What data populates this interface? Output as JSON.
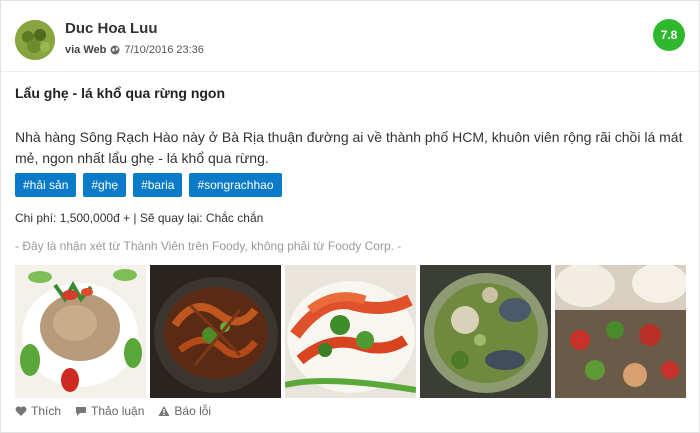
{
  "review": {
    "author": "Duc Hoa Luu",
    "via": "via Web",
    "date": "7/10/2016 23:36",
    "score": "7.8",
    "title": "Lẩu ghẹ - lá khổ qua rừng ngon",
    "body": "Nhà hàng Sông Rạch Hào này ở Bà Rịa thuận đường ai về thành phố HCM, khuôn viên rộng rãi chồi lá mát mẻ, ngon nhất lẩu ghẹ - lá khổ qua rừng.",
    "tags": [
      "#hải sản",
      "#ghẹ",
      "#baria",
      "#songrachhao"
    ],
    "cost_line": "Chi phí: 1,500,000đ + | Sẽ quay lại: Chắc chắn",
    "disclaimer": "- Đây là nhận xét từ Thành Viên trên Foody, không phải từ Foody Corp. -",
    "photos": [
      "rice-salad-photo",
      "clay-pot-shrimp-photo",
      "grilled-prawns-photo",
      "crab-hotpot-photo",
      "platter-photo"
    ]
  },
  "actions": {
    "like": "Thích",
    "discuss": "Thảo luận",
    "report": "Báo lỗi"
  },
  "colors": {
    "score_bg": "#2eb82e",
    "tag_bg": "#0a7bc8"
  }
}
